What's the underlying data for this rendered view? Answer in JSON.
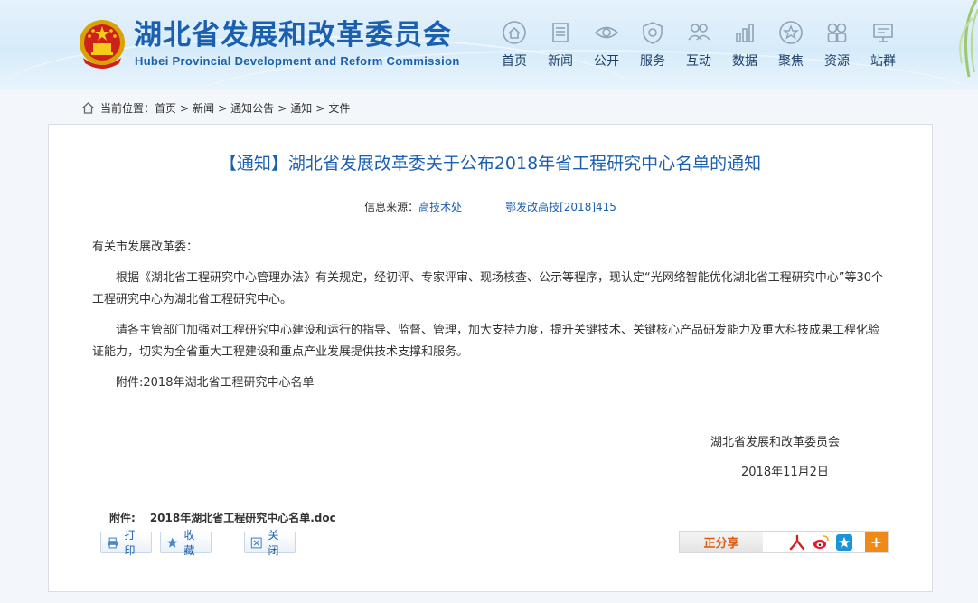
{
  "header": {
    "title": "湖北省发展和改革委员会",
    "subtitle": "Hubei Provincial Development and Reform Commission",
    "nav": [
      {
        "label": "首页",
        "icon": "home-icon"
      },
      {
        "label": "新闻",
        "icon": "news-icon"
      },
      {
        "label": "公开",
        "icon": "eye-icon"
      },
      {
        "label": "服务",
        "icon": "shield-icon"
      },
      {
        "label": "互动",
        "icon": "people-icon"
      },
      {
        "label": "数据",
        "icon": "bar-chart-icon"
      },
      {
        "label": "聚焦",
        "icon": "star-icon"
      },
      {
        "label": "资源",
        "icon": "grid-icon"
      },
      {
        "label": "站群",
        "icon": "monitor-icon"
      }
    ]
  },
  "breadcrumb": {
    "prefix": "当前位置：",
    "items": [
      "首页",
      "新闻",
      "通知公告",
      "通知",
      "文件"
    ],
    "separator": ">"
  },
  "article": {
    "title": "【通知】湖北省发展改革委关于公布2018年省工程研究中心名单的通知",
    "source_label": "信息来源：",
    "source_value": "高技术处",
    "doc_number": "鄂发改高技[2018]415",
    "salutation": "有关市发展改革委：",
    "paragraphs": [
      "根据《湖北省工程研究中心管理办法》有关规定，经初评、专家评审、现场核查、公示等程序，现认定“光网络智能优化湖北省工程研究中心”等30个工程研究中心为湖北省工程研究中心。",
      "请各主管部门加强对工程研究中心建设和运行的指导、监督、管理，加大支持力度，提升关键技术、关键核心产品研发能力及重大科技成果工程化验证能力，切实为全省重大工程建设和重点产业发展提供技术支撑和服务。",
      "附件:2018年湖北省工程研究中心名单"
    ],
    "signature": "湖北省发展和改革委员会",
    "date": "2018年11月2日"
  },
  "attachment": {
    "label": "附件:",
    "file": "2018年湖北省工程研究中心名单.doc"
  },
  "toolbar": {
    "print_label": "打印",
    "favorite_label": "收藏",
    "close_label": "关闭"
  },
  "share": {
    "label": "正分享",
    "more_label": "+"
  },
  "colors": {
    "brand_blue": "#1a5fb0",
    "share_orange": "#f08a16",
    "header_bg": "#d6ebfa"
  }
}
